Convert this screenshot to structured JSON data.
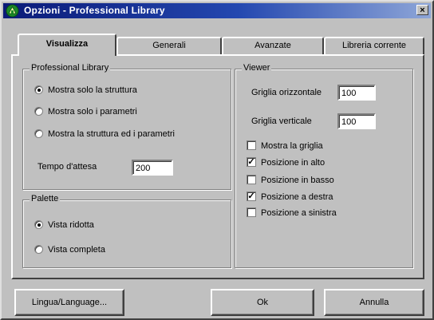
{
  "window": {
    "title": "Opzioni - Professional Library",
    "close_label": "×"
  },
  "tabs": [
    {
      "label": "Visualizza",
      "active": true
    },
    {
      "label": "Generali",
      "active": false
    },
    {
      "label": "Avanzate",
      "active": false
    },
    {
      "label": "Libreria corrente",
      "active": false
    }
  ],
  "professional_library": {
    "title": "Professional Library",
    "options": [
      {
        "label": "Mostra solo la struttura",
        "selected": true
      },
      {
        "label": "Mostra solo i parametri",
        "selected": false
      },
      {
        "label": "Mostra la struttura ed i parametri",
        "selected": false
      }
    ],
    "wait_label": "Tempo d'attesa",
    "wait_value": "200"
  },
  "palette": {
    "title": "Palette",
    "options": [
      {
        "label": "Vista ridotta",
        "selected": true
      },
      {
        "label": "Vista completa",
        "selected": false
      }
    ]
  },
  "viewer": {
    "title": "Viewer",
    "grid_h_label": "Griglia orizzontale",
    "grid_h_value": "100",
    "grid_v_label": "Griglia verticale",
    "grid_v_value": "100",
    "checks": [
      {
        "label": "Mostra la griglia",
        "checked": false
      },
      {
        "label": "Posizione in alto",
        "checked": true
      },
      {
        "label": "Posizione in basso",
        "checked": false
      },
      {
        "label": "Posizione a destra",
        "checked": true
      },
      {
        "label": "Posizione a sinistra",
        "checked": false
      }
    ],
    "check_mark": "✓"
  },
  "buttons": {
    "language": "Lingua/Language...",
    "ok": "Ok",
    "cancel": "Annulla"
  }
}
